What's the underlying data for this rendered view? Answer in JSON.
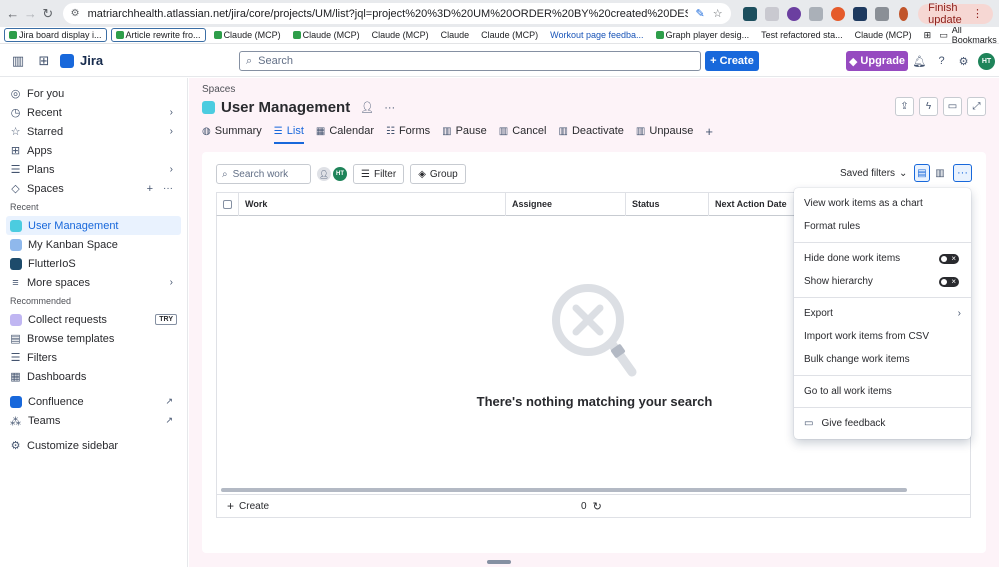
{
  "browser": {
    "url": "matriarchhealth.atlassian.net/jira/core/projects/UM/list?jql=project%20%3D%20UM%20ORDER%20BY%20created%20DESC",
    "finish_update": "Finish update",
    "bookmarks": [
      {
        "label": "Jira board display i...",
        "style": "boxed-check"
      },
      {
        "label": "Article rewrite fro...",
        "style": "boxed-check"
      },
      {
        "label": "Claude (MCP)",
        "style": "check"
      },
      {
        "label": "Claude (MCP)",
        "style": "check"
      },
      {
        "label": "Claude (MCP)",
        "style": "plain"
      },
      {
        "label": "Claude",
        "style": "plain"
      },
      {
        "label": "Claude (MCP)",
        "style": "plain"
      },
      {
        "label": "Workout page feedba...",
        "style": "blue"
      },
      {
        "label": "Graph player desig...",
        "style": "check"
      },
      {
        "label": "Test refactored sta...",
        "style": "plain"
      },
      {
        "label": "Claude (MCP)",
        "style": "plain"
      }
    ],
    "all_bookmarks": "All Bookmarks"
  },
  "topnav": {
    "app_name": "Jira",
    "search_placeholder": "Search",
    "create_label": "Create",
    "upgrade_label": "Upgrade",
    "user_initials": "HT"
  },
  "sidebar": {
    "for_you": "For you",
    "recent": "Recent",
    "starred": "Starred",
    "apps": "Apps",
    "plans": "Plans",
    "spaces": "Spaces",
    "section_recent": "Recent",
    "recent_spaces": [
      "User Management",
      "My Kanban Space",
      "FlutterIoS"
    ],
    "more_spaces": "More spaces",
    "section_recommended": "Recommended",
    "collect_requests": "Collect requests",
    "try_badge": "TRY",
    "browse_templates": "Browse templates",
    "filters": "Filters",
    "dashboards": "Dashboards",
    "confluence": "Confluence",
    "teams": "Teams",
    "customize": "Customize sidebar"
  },
  "project": {
    "breadcrumb": "Spaces",
    "title": "User Management",
    "tabs": [
      "Summary",
      "List",
      "Calendar",
      "Forms",
      "Pause",
      "Cancel",
      "Deactivate",
      "Unpause"
    ],
    "active_tab": "List"
  },
  "list": {
    "search_placeholder": "Search work",
    "avatar_initials": "HT",
    "filter_label": "Filter",
    "group_label": "Group",
    "saved_filters": "Saved filters",
    "columns": [
      "Work",
      "Assignee",
      "Status",
      "Next Action Date"
    ],
    "empty_message": "There's nothing matching your search",
    "footer_create": "Create",
    "count": "0"
  },
  "menu": {
    "view_as_chart": "View work items as a chart",
    "format_rules": "Format rules",
    "hide_done": "Hide done work items",
    "show_hierarchy": "Show hierarchy",
    "export": "Export",
    "import_csv": "Import work items from CSV",
    "bulk_change": "Bulk change work items",
    "go_to_all": "Go to all work items",
    "give_feedback": "Give feedback"
  }
}
